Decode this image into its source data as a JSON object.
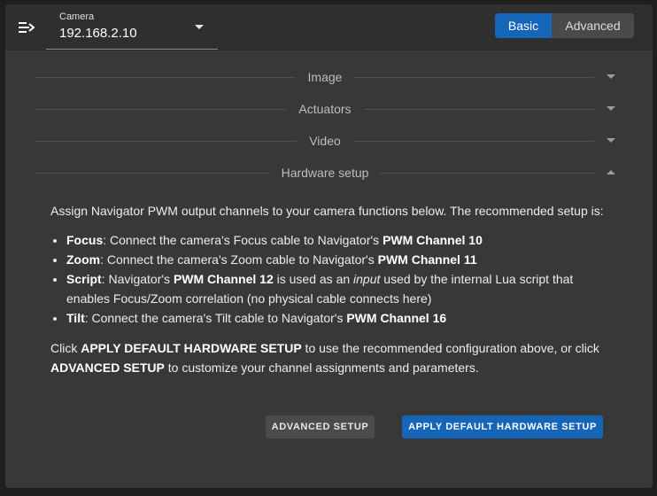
{
  "topbar": {
    "menu_icon": "collapse-menu-icon",
    "camera_select": {
      "label": "Camera",
      "value": "192.168.2.10"
    },
    "mode": {
      "basic": "Basic",
      "advanced": "Advanced",
      "selected": "Basic"
    }
  },
  "sections": [
    {
      "title": "Image",
      "expanded": false
    },
    {
      "title": "Actuators",
      "expanded": false
    },
    {
      "title": "Video",
      "expanded": false
    },
    {
      "title": "Hardware setup",
      "expanded": true
    }
  ],
  "hardware": {
    "intro": "Assign Navigator PWM output channels to your camera functions below. The recommended setup is:",
    "items": [
      {
        "name": "Focus",
        "text1": ": Connect the camera's Focus cable to Navigator's ",
        "channel": "PWM Channel 10"
      },
      {
        "name": "Zoom",
        "text1": ": Connect the camera's Zoom cable to Navigator's ",
        "channel": "PWM Channel 11"
      },
      {
        "name": "Script",
        "text1": ": Navigator's ",
        "channel": "PWM Channel 12",
        "text2": " is used as an ",
        "emph": "input",
        "text3": " used by the internal Lua script that enables Focus/Zoom correlation (no physical cable connects here)"
      },
      {
        "name": "Tilt",
        "text1": ": Connect the camera's Tilt cable to Navigator's ",
        "channel": "PWM Channel 16"
      }
    ],
    "footer": {
      "pre": "Click ",
      "apply_ref": "APPLY DEFAULT HARDWARE SETUP",
      "mid": " to use the recommended configuration above, or click ",
      "adv_ref": "ADVANCED SETUP",
      "post": " to customize your channel assignments and parameters."
    },
    "buttons": {
      "advanced": "ADVANCED SETUP",
      "apply": "APPLY DEFAULT HARDWARE SETUP"
    }
  },
  "colors": {
    "accent": "#1566b8",
    "panel": "#383838",
    "topbar": "#2f2f2f"
  }
}
